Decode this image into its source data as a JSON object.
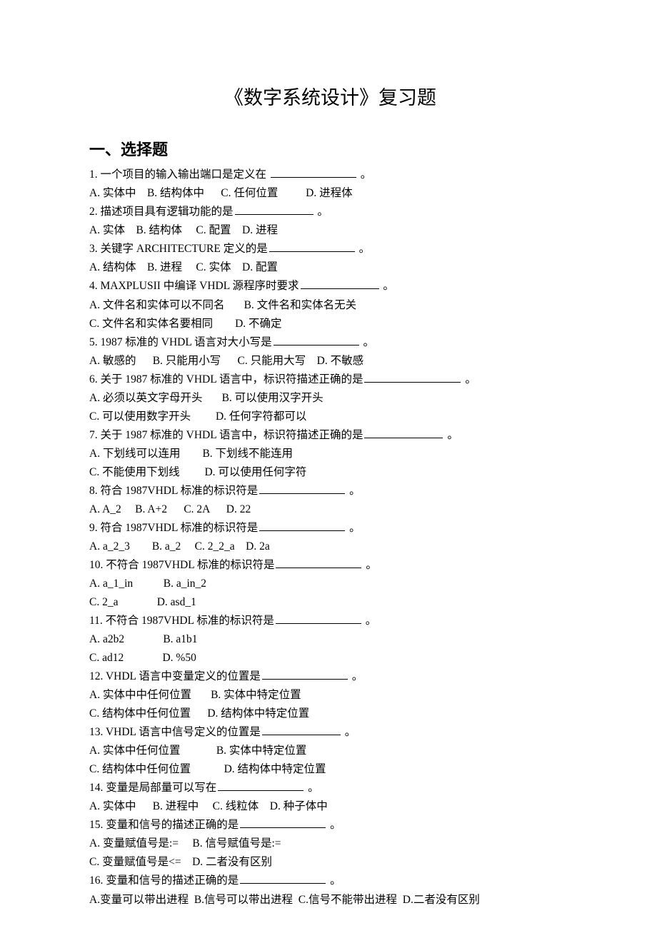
{
  "title": "《数字系统设计》复习题",
  "section1_header": "一、选择题",
  "q1": {
    "text": "1. 一个项目的输入输出端口是定义在 ",
    "suffix": " 。",
    "opts": "A. 实体中    B. 结构体中      C. 任何位置          D. 进程体"
  },
  "q2": {
    "text": "2. 描述项目具有逻辑功能的是",
    "suffix": " 。",
    "opts": "A. 实体    B. 结构体     C. 配置    D. 进程"
  },
  "q3": {
    "text": "3. 关键字 ARCHITECTURE 定义的是",
    "suffix": " 。",
    "opts": "A. 结构体    B. 进程     C. 实体    D. 配置"
  },
  "q4": {
    "text": "4. MAXPLUSII 中编译 VHDL 源程序时要求",
    "suffix": " 。",
    "opts1": "A. 文件名和实体可以不同名       B. 文件名和实体名无关",
    "opts2": "C. 文件名和实体名要相同        D. 不确定"
  },
  "q5": {
    "text": "5. 1987 标准的 VHDL 语言对大小写是",
    "suffix": " 。",
    "opts": "A. 敏感的      B. 只能用小写      C. 只能用大写    D. 不敏感"
  },
  "q6": {
    "text": "6. 关于 1987 标准的 VHDL 语言中，标识符描述正确的是",
    "suffix": " 。",
    "opts1": "A. 必须以英文字母开头       B. 可以使用汉字开头",
    "opts2": "C. 可以使用数字开头         D. 任何字符都可以"
  },
  "q7": {
    "text": "7. 关于 1987 标准的 VHDL 语言中，标识符描述正确的是",
    "suffix": " 。",
    "opts1": "A. 下划线可以连用        B. 下划线不能连用",
    "opts2": "C. 不能使用下划线         D. 可以使用任何字符"
  },
  "q8": {
    "text": "8. 符合 1987VHDL 标准的标识符是",
    "suffix": " 。",
    "opts": "A. A_2     B. A+2      C. 2A      D. 22"
  },
  "q9": {
    "text": "9. 符合 1987VHDL 标准的标识符是",
    "suffix": " 。",
    "opts": "A. a_2_3        B. a_2     C. 2_2_a    D. 2a"
  },
  "q10": {
    "text": "10. 不符合 1987VHDL 标准的标识符是",
    "suffix": " 。",
    "opts1": "A. a_1_in           B. a_in_2",
    "opts2": "C. 2_a              D. asd_1"
  },
  "q11": {
    "text": "11. 不符合 1987VHDL 标准的标识符是",
    "suffix": " 。",
    "opts1": "A. a2b2              B. a1b1",
    "opts2": "C. ad12              D. %50"
  },
  "q12": {
    "text": "12. VHDL 语言中变量定义的位置是",
    "suffix": " 。",
    "opts1": "A. 实体中中任何位置       B. 实体中特定位置",
    "opts2": "C. 结构体中任何位置      D. 结构体中特定位置"
  },
  "q13": {
    "text": "13. VHDL 语言中信号定义的位置是",
    "suffix": " 。",
    "opts1": "A. 实体中任何位置             B. 实体中特定位置",
    "opts2": "C. 结构体中任何位置            D. 结构体中特定位置"
  },
  "q14": {
    "text": "14. 变量是局部量可以写在",
    "suffix": " 。",
    "opts": "A. 实体中      B. 进程中     C. 线粒体    D. 种子体中"
  },
  "q15": {
    "text": "15. 变量和信号的描述正确的是",
    "suffix": " 。",
    "opts1": "A. 变量赋值号是:=     B. 信号赋值号是:=",
    "opts2": "C. 变量赋值号是<=    D. 二者没有区别"
  },
  "q16": {
    "text": "16. 变量和信号的描述正确的是",
    "suffix": " 。",
    "opts": "A.变量可以带出进程  B.信号可以带出进程  C.信号不能带出进程  D.二者没有区别"
  }
}
